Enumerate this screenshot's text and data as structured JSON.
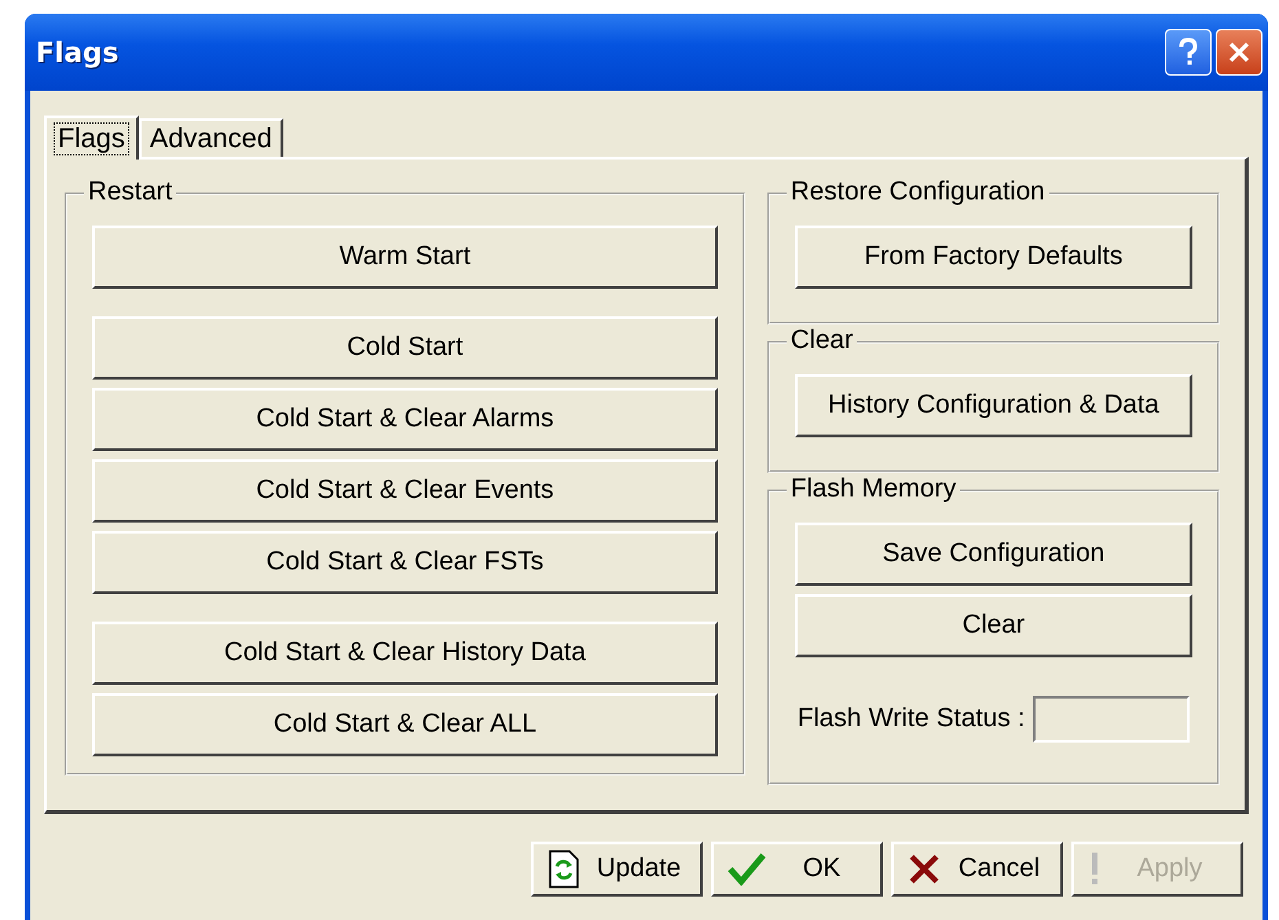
{
  "window": {
    "title": "Flags"
  },
  "tabs": [
    {
      "label": "Flags",
      "selected": true
    },
    {
      "label": "Advanced",
      "selected": false
    }
  ],
  "restart": {
    "title": "Restart",
    "buttons": [
      {
        "label": "Warm Start",
        "gap_after": true
      },
      {
        "label": "Cold Start",
        "gap_after": false
      },
      {
        "label": "Cold Start & Clear Alarms",
        "gap_after": false
      },
      {
        "label": "Cold Start & Clear Events",
        "gap_after": false
      },
      {
        "label": "Cold Start & Clear FSTs",
        "gap_after": true
      },
      {
        "label": "Cold Start & Clear History Data",
        "gap_after": false
      },
      {
        "label": "Cold Start & Clear ALL",
        "gap_after": false
      }
    ]
  },
  "restore_configuration": {
    "title": "Restore Configuration",
    "buttons": [
      {
        "label": "From Factory Defaults"
      }
    ]
  },
  "clear": {
    "title": "Clear",
    "buttons": [
      {
        "label": "History Configuration & Data"
      }
    ]
  },
  "flash_memory": {
    "title": "Flash Memory",
    "buttons": [
      {
        "label": "Save Configuration"
      },
      {
        "label": "Clear"
      }
    ],
    "status_label": "Flash Write Status :"
  },
  "buttons": [
    {
      "kind": "update",
      "label": "Update",
      "disabled": false
    },
    {
      "kind": "ok",
      "label": "OK",
      "disabled": false
    },
    {
      "kind": "cancel",
      "label": "Cancel",
      "disabled": false
    },
    {
      "kind": "apply",
      "label": "Apply",
      "disabled": true
    }
  ]
}
